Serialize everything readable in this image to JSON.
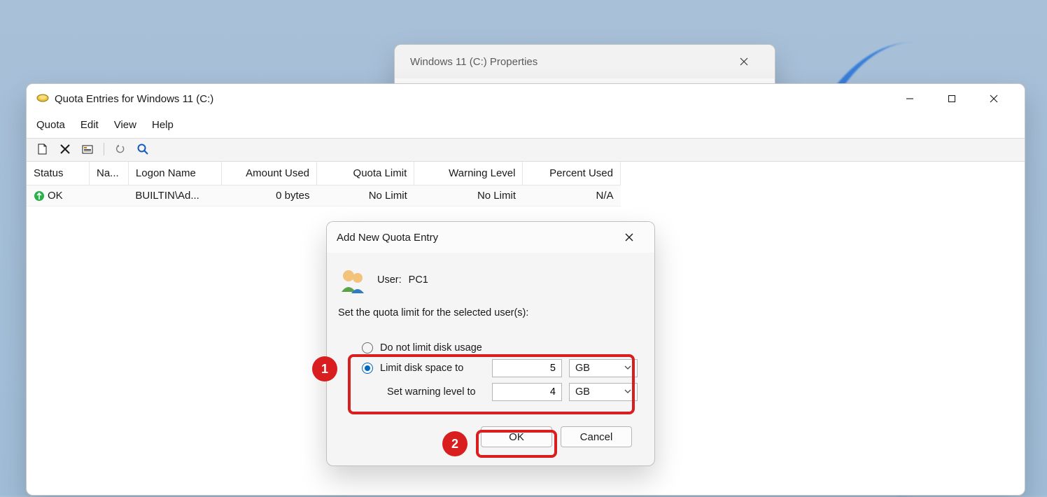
{
  "background_window": {
    "title": "Windows 11 (C:) Properties"
  },
  "quota_window": {
    "title": "Quota Entries for Windows 11 (C:)",
    "menus": {
      "quota": "Quota",
      "edit": "Edit",
      "view": "View",
      "help": "Help"
    },
    "headers": {
      "status": "Status",
      "name": "Na...",
      "logon": "Logon Name",
      "amount": "Amount Used",
      "limit": "Quota Limit",
      "warning": "Warning Level",
      "percent": "Percent Used"
    },
    "rows": [
      {
        "status": "OK",
        "name": "",
        "logon": "BUILTIN\\Ad...",
        "amount": "0 bytes",
        "limit": "No Limit",
        "warning": "No Limit",
        "percent": "N/A"
      }
    ]
  },
  "dialog": {
    "title": "Add New Quota Entry",
    "user_label": "User:",
    "user_value": "PC1",
    "instruction": "Set the quota limit for the selected user(s):",
    "opt_no_limit": "Do not limit disk usage",
    "opt_limit": "Limit disk space to",
    "label_warn": "Set warning level to",
    "limit_value": "5",
    "limit_unit": "GB",
    "warn_value": "4",
    "warn_unit": "GB",
    "btn_ok": "OK",
    "btn_cancel": "Cancel"
  },
  "annotations": {
    "badge1": "1",
    "badge2": "2"
  }
}
